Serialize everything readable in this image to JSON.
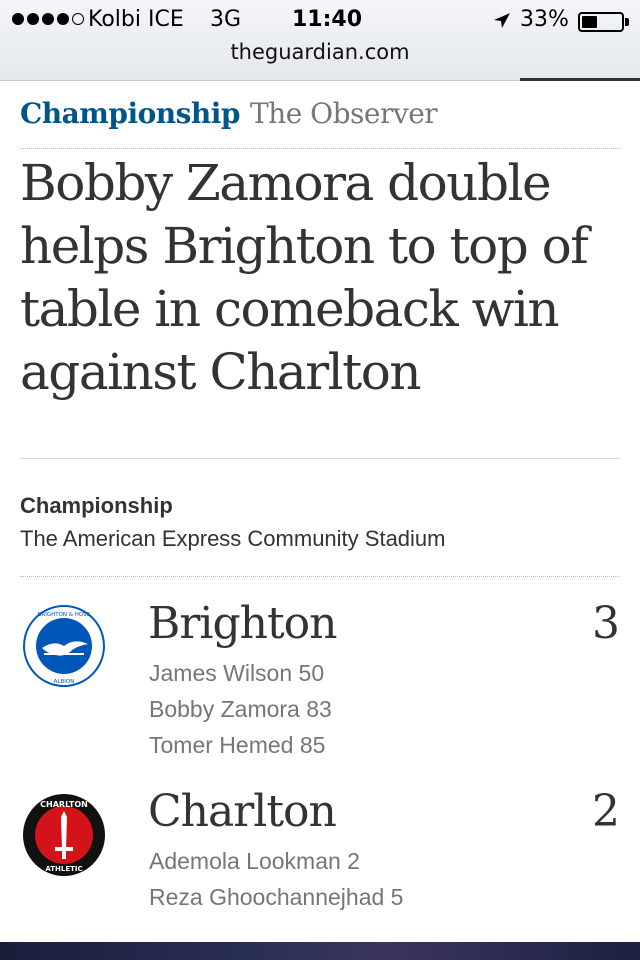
{
  "status_bar": {
    "carrier": "Kolbi ICE",
    "network": "3G",
    "time": "11:40",
    "battery": "33%",
    "battery_level": 0.33,
    "signal_bars": 4
  },
  "browser": {
    "url": "theguardian.com"
  },
  "article": {
    "section": "Championship",
    "series": "The Observer",
    "headline": "Bobby Zamora double helps Brighton to top of table in comeback win against Charlton"
  },
  "match": {
    "competition": "Championship",
    "venue": "The American Express Community Stadium",
    "home": {
      "name": "Brighton",
      "score": "3",
      "crest_text_top": "BRIGHTON & HOVE",
      "crest_text_bottom": "ALBION",
      "scorers": [
        "James Wilson 50",
        "Bobby Zamora 83",
        "Tomer Hemed 85"
      ]
    },
    "away": {
      "name": "Charlton",
      "score": "2",
      "crest_text_top": "CHARLTON",
      "crest_text_bottom": "ATHLETIC",
      "scorers": [
        "Ademola Lookman 2",
        "Reza Ghoochannejhad 5"
      ]
    }
  },
  "colors": {
    "guardian_blue": "#005689",
    "brighton_blue": "#0057b8",
    "charlton_red": "#d4121a"
  }
}
